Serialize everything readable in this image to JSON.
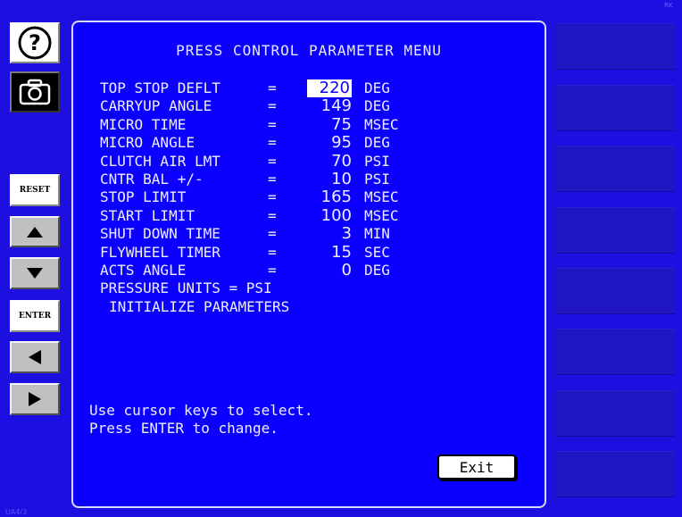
{
  "title": "PRESS CONTROL PARAMETER MENU",
  "parameters": [
    {
      "label": "TOP STOP DEFLT",
      "eq": "=",
      "value": "220",
      "unit": "DEG"
    },
    {
      "label": "CARRYUP ANGLE",
      "eq": "=",
      "value": "149",
      "unit": "DEG"
    },
    {
      "label": "MICRO TIME",
      "eq": "=",
      "value": "75",
      "unit": "MSEC"
    },
    {
      "label": "MICRO ANGLE",
      "eq": "=",
      "value": "95",
      "unit": "DEG"
    },
    {
      "label": "CLUTCH AIR LMT",
      "eq": "=",
      "value": "70",
      "unit": "PSI"
    },
    {
      "label": "CNTR BAL +/-",
      "eq": "=",
      "value": "10",
      "unit": "PSI"
    },
    {
      "label": "STOP LIMIT",
      "eq": "=",
      "value": "165",
      "unit": "MSEC"
    },
    {
      "label": "START LIMIT",
      "eq": "=",
      "value": "100",
      "unit": "MSEC"
    },
    {
      "label": "SHUT DOWN TIME",
      "eq": "=",
      "value": "3",
      "unit": "MIN"
    },
    {
      "label": "FLYWHEEL TIMER",
      "eq": "=",
      "value": "15",
      "unit": "SEC"
    },
    {
      "label": "ACTS ANGLE",
      "eq": "=",
      "value": "0",
      "unit": "DEG"
    }
  ],
  "pressure_units_row": "PRESSURE UNITS = PSI",
  "initialize_row": "INITIALIZE PARAMETERS",
  "help_line1": "Use cursor keys to select.",
  "help_line2": "Press ENTER to change.",
  "exit_label": "Exit",
  "side_buttons": {
    "help": "?",
    "reset": "RESET",
    "enter": "ENTER"
  },
  "corner_tag": "RK",
  "footer_tag": "UA4/3",
  "colors": {
    "background": "#1d0fe0",
    "panel": "#0b00ff",
    "right_panel": "#1f15c2",
    "highlight": "#ffffff"
  },
  "selected_parameter": "TOP STOP DEFLT"
}
